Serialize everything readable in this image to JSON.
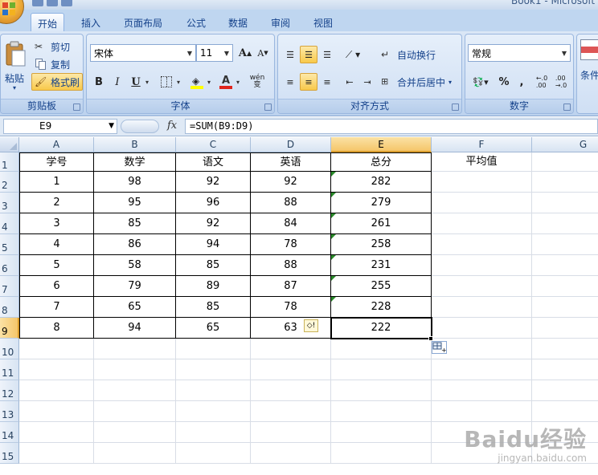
{
  "window": {
    "title": "Book1 - Microsoft"
  },
  "tabs": [
    {
      "label": "开始",
      "active": true
    },
    {
      "label": "插入",
      "active": false
    },
    {
      "label": "页面布局",
      "active": false
    },
    {
      "label": "公式",
      "active": false
    },
    {
      "label": "数据",
      "active": false
    },
    {
      "label": "审阅",
      "active": false
    },
    {
      "label": "视图",
      "active": false
    }
  ],
  "ribbon": {
    "clipboard": {
      "label": "剪贴板",
      "paste": "粘贴",
      "cut": "剪切",
      "copy": "复制",
      "format_painter": "格式刷"
    },
    "font": {
      "label": "字体",
      "family": "宋体",
      "size": "11",
      "bold": "B",
      "italic": "I",
      "underline": "U",
      "grow": "A",
      "shrink": "A",
      "phonetic": "wén\n变"
    },
    "alignment": {
      "label": "对齐方式",
      "wrap_text": "自动换行",
      "merge_center": "合并后居中"
    },
    "number": {
      "label": "数字",
      "format": "常规",
      "percent": "%",
      "comma": ",",
      "inc_decimal": "←.0\n.00",
      "dec_decimal": ".00\n→.0"
    },
    "styles": {
      "conditional_partial": "条件"
    }
  },
  "formula_bar": {
    "name_box": "E9",
    "fx": "fx",
    "formula": "=SUM(B9:D9)"
  },
  "grid": {
    "columns": [
      "A",
      "B",
      "C",
      "D",
      "E",
      "F",
      "G"
    ],
    "row_numbers": [
      "1",
      "2",
      "3",
      "4",
      "5",
      "6",
      "7",
      "8",
      "9",
      "10",
      "11",
      "12",
      "13",
      "14",
      "15"
    ],
    "headers": [
      "学号",
      "数学",
      "语文",
      "英语",
      "总分",
      "平均值"
    ],
    "rows": [
      [
        "1",
        "98",
        "92",
        "92",
        "282"
      ],
      [
        "2",
        "95",
        "96",
        "88",
        "279"
      ],
      [
        "3",
        "85",
        "92",
        "84",
        "261"
      ],
      [
        "4",
        "86",
        "94",
        "78",
        "258"
      ],
      [
        "5",
        "58",
        "85",
        "88",
        "231"
      ],
      [
        "6",
        "79",
        "89",
        "87",
        "255"
      ],
      [
        "7",
        "65",
        "85",
        "78",
        "228"
      ],
      [
        "8",
        "94",
        "65",
        "63",
        "222"
      ]
    ],
    "active_cell": "E9"
  },
  "watermark": {
    "logo": "Baidu经验",
    "url": "jingyan.baidu.com"
  },
  "colors": {
    "selection_header": "#f5c66a",
    "ribbon": "#c7daf2",
    "error_triangle": "#2a8a2a"
  }
}
